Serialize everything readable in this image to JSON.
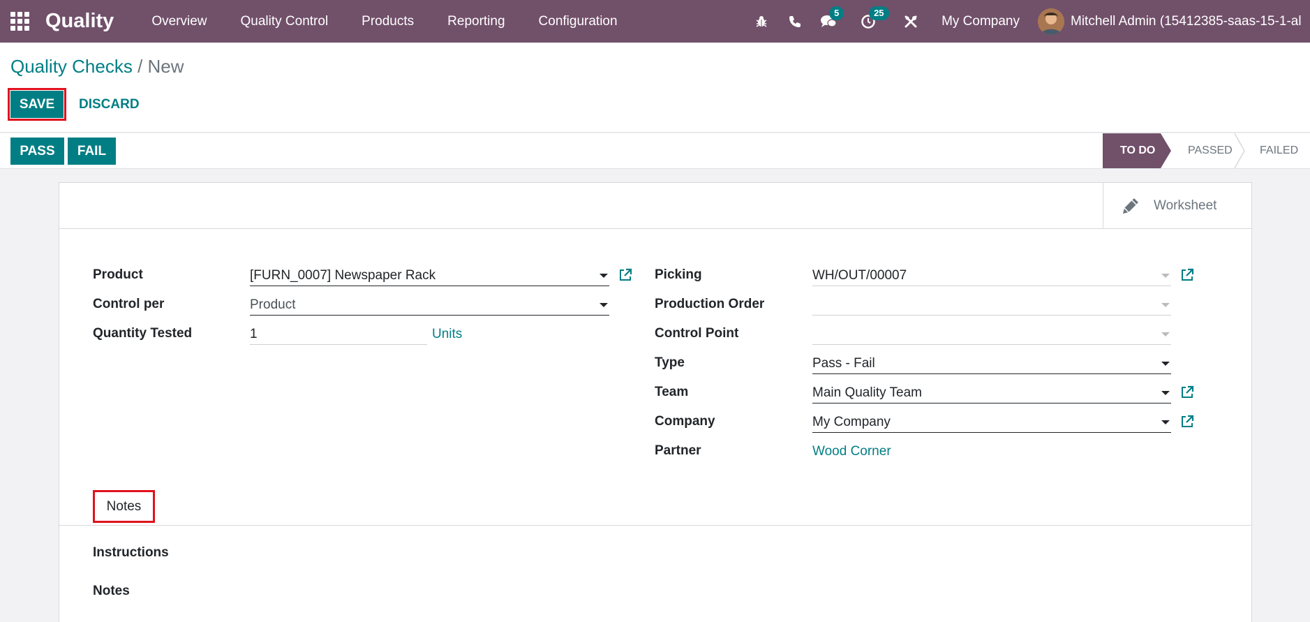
{
  "navbar": {
    "brand": "Quality",
    "menu": [
      "Overview",
      "Quality Control",
      "Products",
      "Reporting",
      "Configuration"
    ],
    "messages_badge": "5",
    "activities_badge": "25",
    "company": "My Company",
    "user": "Mitchell Admin (15412385-saas-15-1-al",
    "icons": [
      "apps-grid-icon",
      "bug-icon",
      "phone-icon",
      "chat-icon",
      "clock-icon",
      "tools-icon"
    ],
    "color": "#71506a"
  },
  "breadcrumb": {
    "parent": "Quality Checks",
    "separator": " / ",
    "current": "New"
  },
  "buttons": {
    "save": "SAVE",
    "discard": "DISCARD",
    "pass": "PASS",
    "fail": "FAIL"
  },
  "stages": {
    "todo": "TO DO",
    "passed": "PASSED",
    "failed": "FAILED",
    "active": "TO DO"
  },
  "worksheet": {
    "label": "Worksheet"
  },
  "form": {
    "left": {
      "product": {
        "label": "Product",
        "value": "[FURN_0007] Newspaper Rack"
      },
      "control_per": {
        "label": "Control per",
        "value": "Product"
      },
      "quantity_tested": {
        "label": "Quantity Tested",
        "value": "1",
        "unit": "Units"
      }
    },
    "right": {
      "picking": {
        "label": "Picking",
        "value": "WH/OUT/00007"
      },
      "production_order": {
        "label": "Production Order",
        "value": ""
      },
      "control_point": {
        "label": "Control Point",
        "value": ""
      },
      "type": {
        "label": "Type",
        "value": "Pass - Fail"
      },
      "team": {
        "label": "Team",
        "value": "Main Quality Team"
      },
      "company": {
        "label": "Company",
        "value": "My Company"
      },
      "partner": {
        "label": "Partner",
        "value": "Wood Corner"
      }
    }
  },
  "tabs": {
    "notes": "Notes"
  },
  "notes_section": {
    "instructions_label": "Instructions",
    "notes_label": "Notes"
  },
  "colors": {
    "accent": "#017e84",
    "highlight": "#e0121e"
  }
}
